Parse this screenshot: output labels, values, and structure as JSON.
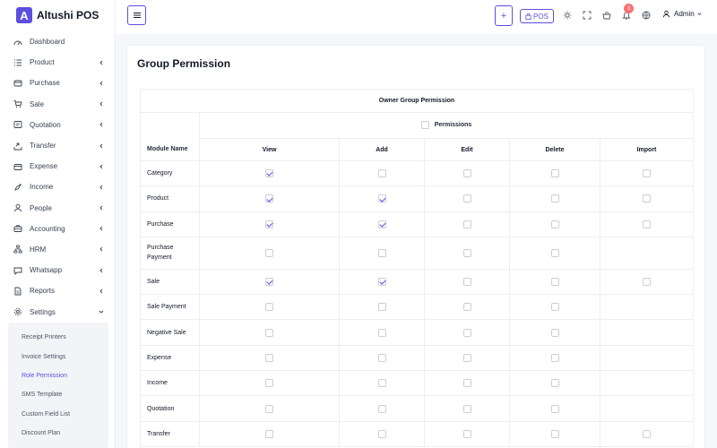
{
  "app": {
    "logo_letter": "A",
    "name": "Altushi POS"
  },
  "sidebar": {
    "items": [
      {
        "label": "Dashboard",
        "icon": "gauge-icon",
        "chevron": false
      },
      {
        "label": "Product",
        "icon": "list-icon",
        "chevron": true
      },
      {
        "label": "Purchase",
        "icon": "card-icon",
        "chevron": true
      },
      {
        "label": "Sale",
        "icon": "cart-icon",
        "chevron": true
      },
      {
        "label": "Quotation",
        "icon": "quote-icon",
        "chevron": true
      },
      {
        "label": "Transfer",
        "icon": "share-icon",
        "chevron": true
      },
      {
        "label": "Expense",
        "icon": "wallet-icon",
        "chevron": true
      },
      {
        "label": "Income",
        "icon": "rocket-icon",
        "chevron": true
      },
      {
        "label": "People",
        "icon": "user-icon",
        "chevron": true
      },
      {
        "label": "Accounting",
        "icon": "briefcase-icon",
        "chevron": true
      },
      {
        "label": "HRM",
        "icon": "org-icon",
        "chevron": true
      },
      {
        "label": "Whatsapp",
        "icon": "chat-icon",
        "chevron": true
      },
      {
        "label": "Reports",
        "icon": "doc-icon",
        "chevron": true
      },
      {
        "label": "Settings",
        "icon": "gear-icon",
        "chevron": true
      }
    ],
    "settings_sub": [
      "Receipt Printers",
      "Invoice Settings",
      "Role Permission",
      "SMS Template",
      "Custom Field List",
      "Discount Plan"
    ],
    "active_sub": "Role Permission"
  },
  "topbar": {
    "plus_label": "+",
    "pos_label": "POS",
    "notification_count": "3",
    "user_name": "Admin"
  },
  "page": {
    "title": "Group Permission",
    "table_title": "Owner Group Permission",
    "permissions_label": "Permissions",
    "module_header": "Module Name",
    "columns": [
      "View",
      "Add",
      "Edit",
      "Delete",
      "Import"
    ]
  },
  "rows": [
    {
      "name": "Category",
      "view": true,
      "add": false,
      "edit": false,
      "delete": false,
      "import": false
    },
    {
      "name": "Product",
      "view": true,
      "add": true,
      "edit": false,
      "delete": false,
      "import": false
    },
    {
      "name": "Purchase",
      "view": true,
      "add": true,
      "edit": false,
      "delete": false,
      "import": false
    },
    {
      "name": "Purchase Payment",
      "view": false,
      "add": false,
      "edit": false,
      "delete": false,
      "import": null
    },
    {
      "name": "Sale",
      "view": true,
      "add": true,
      "edit": false,
      "delete": false,
      "import": false
    },
    {
      "name": "Sale Payment",
      "view": false,
      "add": false,
      "edit": false,
      "delete": false,
      "import": null
    },
    {
      "name": "Negative Sale",
      "view": false,
      "add": false,
      "edit": false,
      "delete": false,
      "import": null
    },
    {
      "name": "Expense",
      "view": false,
      "add": false,
      "edit": false,
      "delete": false,
      "import": null
    },
    {
      "name": "Income",
      "view": false,
      "add": false,
      "edit": false,
      "delete": false,
      "import": null
    },
    {
      "name": "Quotation",
      "view": false,
      "add": false,
      "edit": false,
      "delete": false,
      "import": null
    },
    {
      "name": "Transfer",
      "view": false,
      "add": false,
      "edit": false,
      "delete": false,
      "import": false
    }
  ],
  "colors": {
    "accent": "#5b4fe0",
    "badge": "#f87171",
    "border": "#eceef4"
  }
}
